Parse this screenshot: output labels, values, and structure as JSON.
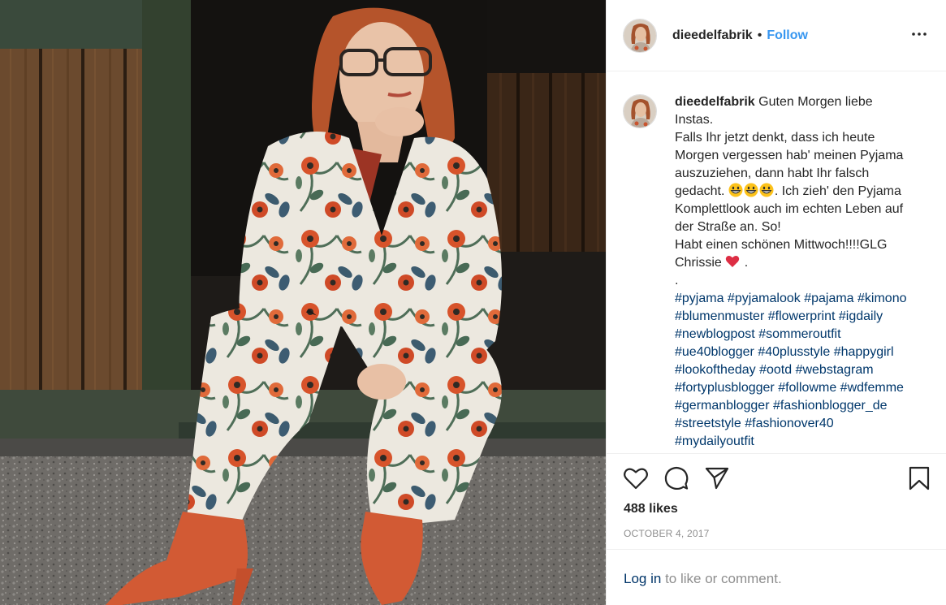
{
  "post": {
    "username": "dieedelfabrik",
    "separator": "•",
    "follow_label": "Follow",
    "more_icon": "more-horizontal-icon"
  },
  "caption": {
    "username": "dieedelfabrik",
    "lines": [
      "Guten Morgen liebe Instas.",
      "Falls Ihr jetzt denkt, dass ich heute Morgen vergessen hab' meinen Pyjama auszuziehen, dann habt Ihr falsch gedacht.",
      ". Ich zieh' den Pyjama Komplettlook auch im echten Leben auf der Straße an. So!",
      "Habt einen schönen Mittwoch!!!!GLG Chrissie",
      "."
    ],
    "emoji": [
      "grinning-face-emoji",
      "grinning-face-emoji",
      "grinning-face-emoji",
      "red-heart-emoji"
    ],
    "hashtags": "#pyjama #pyjamalook #pajama #kimono #blumenmuster #flowerprint #igdaily #newblogpost #sommeroutfit #ue40blogger #40plusstyle #happygirl #lookoftheday #ootd #webstagram #fortyplusblogger #followme #wdfemme #germanblogger #fashionblogger_de #streetstyle #fashionover40 #mydailyoutfit",
    "line_end_period": "."
  },
  "actions": {
    "like_icon": "heart-icon",
    "comment_icon": "comment-icon",
    "share_icon": "share-icon",
    "save_icon": "bookmark-icon"
  },
  "likes_text": "488 likes",
  "date_text": "OCTOBER 4, 2017",
  "login": {
    "link_text": "Log in",
    "rest_text": "to like or comment."
  },
  "colors": {
    "link_blue": "#3897f0",
    "hashtag_blue": "#00376b",
    "muted_gray": "#8e8e8e",
    "text_dark": "#262626",
    "border": "#efefef"
  }
}
